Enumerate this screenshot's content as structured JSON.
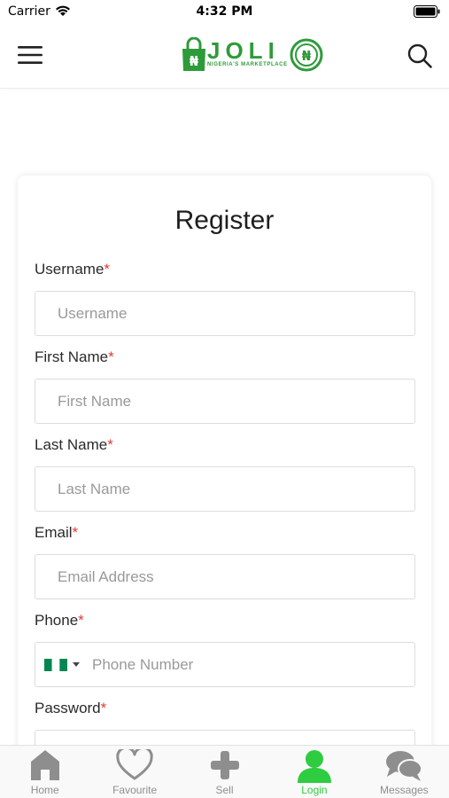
{
  "status_bar": {
    "carrier": "Carrier",
    "time": "4:32 PM"
  },
  "header": {
    "logo_text": "JOLI",
    "logo_tagline": "NIGERIA'S MARKETPLACE",
    "brand_color": "#2e9b3a",
    "menu_icon": "hamburger-menu-icon",
    "search_icon": "search-icon"
  },
  "form": {
    "title": "Register",
    "required_mark": "*",
    "fields": [
      {
        "label": "Username",
        "placeholder": "Username",
        "value": ""
      },
      {
        "label": "First Name",
        "placeholder": "First Name",
        "value": ""
      },
      {
        "label": "Last Name",
        "placeholder": "Last Name",
        "value": ""
      },
      {
        "label": "Email",
        "placeholder": "Email Address",
        "value": ""
      }
    ],
    "phone": {
      "label": "Phone",
      "placeholder": "Phone Number",
      "value": "",
      "country_flag": "nigeria-flag-icon"
    },
    "password": {
      "label": "Password"
    }
  },
  "tab_bar": {
    "active_color": "#2ecc40",
    "inactive_color": "#8e8e8e",
    "tabs": [
      {
        "label": "Home",
        "icon": "home-icon",
        "active": false
      },
      {
        "label": "Favourite",
        "icon": "heart-icon",
        "active": false
      },
      {
        "label": "Sell",
        "icon": "plus-icon",
        "active": false
      },
      {
        "label": "Login",
        "icon": "user-icon",
        "active": true
      },
      {
        "label": "Messages",
        "icon": "chat-bubbles-icon",
        "active": false
      }
    ]
  }
}
